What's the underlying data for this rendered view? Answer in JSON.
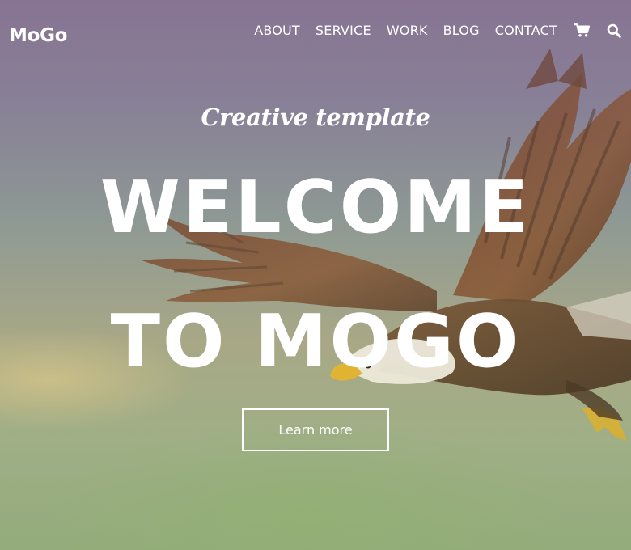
{
  "header": {
    "logo": "MoGo",
    "nav": [
      {
        "label": "ABOUT"
      },
      {
        "label": "SERVICE"
      },
      {
        "label": "WORK"
      },
      {
        "label": "BLOG"
      },
      {
        "label": "CONTACT"
      }
    ],
    "icons": [
      "cart-icon",
      "search-icon"
    ]
  },
  "hero": {
    "subtitle": "Creative template",
    "headline_line1": "WELCOME",
    "headline_line2": "TO MOGO",
    "cta_label": "Learn more",
    "background_image": "eagle in flight"
  },
  "colors": {
    "text": "#ffffff",
    "sky_top": "#8a7a94",
    "sky_bottom": "#97ad7f",
    "eagle_wing": "#6e4a30",
    "eagle_beak": "#e6b530"
  }
}
